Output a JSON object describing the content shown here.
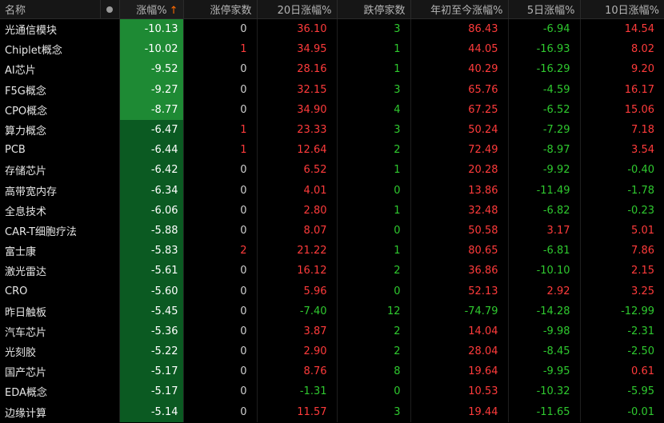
{
  "header": {
    "name": "名称",
    "change_pct": "涨幅%",
    "sort_arrow": "↑",
    "limit_up": "涨停家数",
    "chg_20d": "20日涨幅%",
    "limit_down": "跌停家数",
    "ytd": "年初至今涨幅%",
    "chg_5d": "5日涨幅%",
    "chg_10d": "10日涨幅%"
  },
  "colors": {
    "up": "#ff3b3b",
    "down": "#2fc92f",
    "sort_arrow": "#ff6a00",
    "strong_down_cell": "#1e8a34",
    "down_cell": "#0b5a22"
  },
  "rows": [
    {
      "name": "光通信模块",
      "chg": "-10.13",
      "lu": "0",
      "d20": "36.10",
      "ld": "3",
      "ytd": "86.43",
      "d5": "-6.94",
      "d10": "14.54"
    },
    {
      "name": "Chiplet概念",
      "chg": "-10.02",
      "lu": "1",
      "d20": "34.95",
      "ld": "1",
      "ytd": "44.05",
      "d5": "-16.93",
      "d10": "8.02"
    },
    {
      "name": "AI芯片",
      "chg": "-9.52",
      "lu": "0",
      "d20": "28.16",
      "ld": "1",
      "ytd": "40.29",
      "d5": "-16.29",
      "d10": "9.20"
    },
    {
      "name": "F5G概念",
      "chg": "-9.27",
      "lu": "0",
      "d20": "32.15",
      "ld": "3",
      "ytd": "65.76",
      "d5": "-4.59",
      "d10": "16.17"
    },
    {
      "name": "CPO概念",
      "chg": "-8.77",
      "lu": "0",
      "d20": "34.90",
      "ld": "4",
      "ytd": "67.25",
      "d5": "-6.52",
      "d10": "15.06"
    },
    {
      "name": "算力概念",
      "chg": "-6.47",
      "lu": "1",
      "d20": "23.33",
      "ld": "3",
      "ytd": "50.24",
      "d5": "-7.29",
      "d10": "7.18"
    },
    {
      "name": "PCB",
      "chg": "-6.44",
      "lu": "1",
      "d20": "12.64",
      "ld": "2",
      "ytd": "72.49",
      "d5": "-8.97",
      "d10": "3.54"
    },
    {
      "name": "存储芯片",
      "chg": "-6.42",
      "lu": "0",
      "d20": "6.52",
      "ld": "1",
      "ytd": "20.28",
      "d5": "-9.92",
      "d10": "-0.40"
    },
    {
      "name": "高带宽内存",
      "chg": "-6.34",
      "lu": "0",
      "d20": "4.01",
      "ld": "0",
      "ytd": "13.86",
      "d5": "-11.49",
      "d10": "-1.78"
    },
    {
      "name": "全息技术",
      "chg": "-6.06",
      "lu": "0",
      "d20": "2.80",
      "ld": "1",
      "ytd": "32.48",
      "d5": "-6.82",
      "d10": "-0.23"
    },
    {
      "name": "CAR-T细胞疗法",
      "chg": "-5.88",
      "lu": "0",
      "d20": "8.07",
      "ld": "0",
      "ytd": "50.58",
      "d5": "3.17",
      "d10": "5.01"
    },
    {
      "name": "富士康",
      "chg": "-5.83",
      "lu": "2",
      "d20": "21.22",
      "ld": "1",
      "ytd": "80.65",
      "d5": "-6.81",
      "d10": "7.86"
    },
    {
      "name": "激光雷达",
      "chg": "-5.61",
      "lu": "0",
      "d20": "16.12",
      "ld": "2",
      "ytd": "36.86",
      "d5": "-10.10",
      "d10": "2.15"
    },
    {
      "name": "CRO",
      "chg": "-5.60",
      "lu": "0",
      "d20": "5.96",
      "ld": "0",
      "ytd": "52.13",
      "d5": "2.92",
      "d10": "3.25"
    },
    {
      "name": "昨日触板",
      "chg": "-5.45",
      "lu": "0",
      "d20": "-7.40",
      "ld": "12",
      "ytd": "-74.79",
      "d5": "-14.28",
      "d10": "-12.99"
    },
    {
      "name": "汽车芯片",
      "chg": "-5.36",
      "lu": "0",
      "d20": "3.87",
      "ld": "2",
      "ytd": "14.04",
      "d5": "-9.98",
      "d10": "-2.31"
    },
    {
      "name": "光刻胶",
      "chg": "-5.22",
      "lu": "0",
      "d20": "2.90",
      "ld": "2",
      "ytd": "28.04",
      "d5": "-8.45",
      "d10": "-2.50"
    },
    {
      "name": "国产芯片",
      "chg": "-5.17",
      "lu": "0",
      "d20": "8.76",
      "ld": "8",
      "ytd": "19.64",
      "d5": "-9.95",
      "d10": "0.61"
    },
    {
      "name": "EDA概念",
      "chg": "-5.17",
      "lu": "0",
      "d20": "-1.31",
      "ld": "0",
      "ytd": "10.53",
      "d5": "-10.32",
      "d10": "-5.95"
    },
    {
      "name": "边缘计算",
      "chg": "-5.14",
      "lu": "0",
      "d20": "11.57",
      "ld": "3",
      "ytd": "19.44",
      "d5": "-11.65",
      "d10": "-0.01"
    }
  ]
}
